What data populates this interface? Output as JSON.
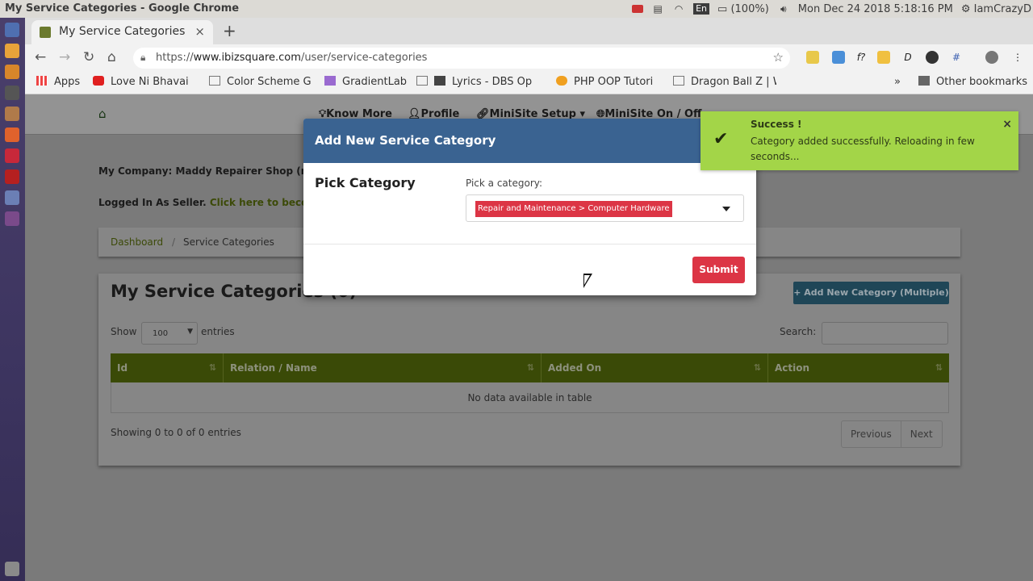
{
  "os": {
    "window_title": "My Service Categories - Google Chrome",
    "battery": "(100%)",
    "datetime": "Mon Dec 24 2018  5:18:16 PM",
    "user": "IamCrazyD",
    "keyboard_layout": "En"
  },
  "browser": {
    "tab_title": "My Service Categories",
    "new_tab": "+",
    "close_tab": "×",
    "url_prefix": "https://",
    "url_host": "www.ibizsquare.com",
    "url_path": "/user/service-categories",
    "bookmarks": [
      "Apps",
      "Love Ni Bhavai |",
      "Color Scheme G",
      "GradientLab",
      "Lyrics - DBS Op",
      "PHP OOP Tutori",
      "Dragon Ball Z | W"
    ],
    "more_bookmarks": "»",
    "other_bookmarks": "Other bookmarks",
    "ext_f": "f?",
    "ext_d": "D"
  },
  "site": {
    "nav": [
      "Know More",
      "Profile",
      "MiniSite Setup",
      "MiniSite On / Off"
    ],
    "company": "My Company: Maddy Repairer Shop (ma",
    "logged_in": "Logged In As Seller.",
    "become_link": "Click here to becom",
    "breadcrumb": [
      "Dashboard",
      "Service Categories"
    ],
    "breadcrumb_sep": "/",
    "page_title": "My Service Categories (0)",
    "add_button": "+ Add New Category (Multiple)",
    "show_label": "Show",
    "entries_value": "100",
    "entries_label": "entries",
    "search_label": "Search:",
    "columns": [
      "Id",
      "Relation / Name",
      "Added On",
      "Action"
    ],
    "no_data": "No data available in table",
    "showing": "Showing 0 to 0 of 0 entries",
    "previous": "Previous",
    "next": "Next"
  },
  "modal": {
    "title": "Add New Service Category",
    "section_label": "Pick Category",
    "field_label": "Pick a category:",
    "selected": "Repair and Maintenance > Computer Hardware",
    "submit": "Submit"
  },
  "toast": {
    "title": "Success !",
    "message": "Category added successfully. Reloading in few seconds...",
    "close": "×"
  },
  "colors": {
    "accent_modal": "#3a6391",
    "danger": "#dc3545",
    "success_toast": "#a3d548",
    "table_header": "#3a4a07"
  }
}
